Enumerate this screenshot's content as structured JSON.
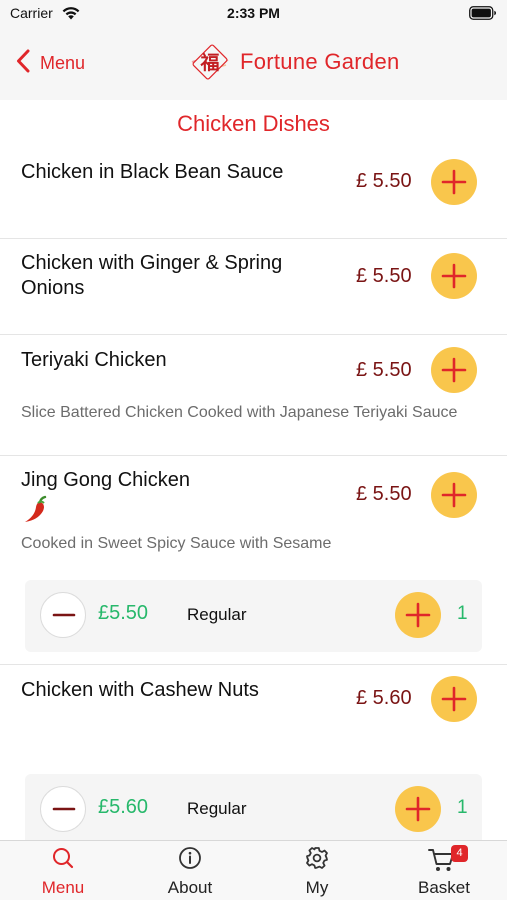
{
  "status_bar": {
    "carrier": "Carrier",
    "time": "2:33 PM",
    "icons": [
      "wifi-icon",
      "battery-icon"
    ]
  },
  "nav": {
    "back_label": "Menu",
    "brand_name": "Fortune Garden",
    "brand_logo_glyph": "福",
    "icons": [
      "chevron-left-icon",
      "fortune-logo-icon"
    ]
  },
  "section_title": "Chicken Dishes",
  "dishes": [
    {
      "name": "Chicken in Black Bean Sauce",
      "price": "£ 5.50"
    },
    {
      "name": "Chicken with Ginger & Spring Onions",
      "price": "£ 5.50"
    },
    {
      "name": "Teriyaki Chicken",
      "price": "£ 5.50",
      "description": "Slice Battered Chicken Cooked with Japanese Teriyaki Sauce"
    },
    {
      "name": "Jing Gong Chicken",
      "price": "£ 5.50",
      "description": "Cooked in Sweet Spicy Sauce with Sesame",
      "spicy_icon": "chili-pepper-icon",
      "option": {
        "price": "£5.50",
        "label": "Regular",
        "quantity": "1"
      }
    },
    {
      "name": "Chicken with Cashew Nuts",
      "price": "£ 5.60",
      "option": {
        "price": "£5.60",
        "label": "Regular",
        "quantity": "1"
      }
    }
  ],
  "tabs": [
    {
      "label": "Menu",
      "icon": "search-icon",
      "active": true
    },
    {
      "label": "About",
      "icon": "info-icon",
      "active": false
    },
    {
      "label": "My",
      "icon": "gear-icon",
      "active": false
    },
    {
      "label": "Basket",
      "icon": "cart-icon",
      "active": false,
      "badge": "4"
    }
  ],
  "colors": {
    "accent_red": "#e0262a",
    "price_maroon": "#7a1414",
    "add_button_yellow": "#f9c64c",
    "option_green": "#27b86b"
  }
}
